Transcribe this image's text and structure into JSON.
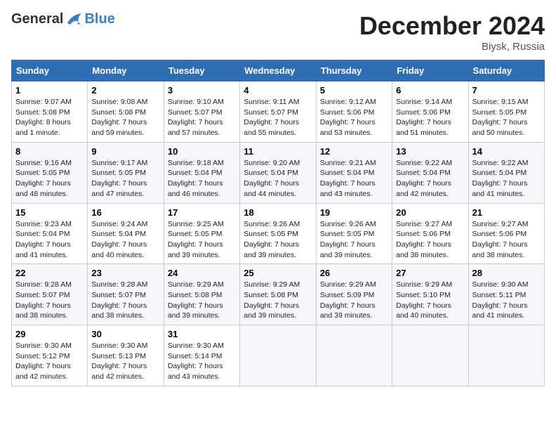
{
  "logo": {
    "general": "General",
    "blue": "Blue"
  },
  "title": "December 2024",
  "location": "Biysk, Russia",
  "days_header": [
    "Sunday",
    "Monday",
    "Tuesday",
    "Wednesday",
    "Thursday",
    "Friday",
    "Saturday"
  ],
  "weeks": [
    [
      {
        "day": "1",
        "info": "Sunrise: 9:07 AM\nSunset: 5:08 PM\nDaylight: 8 hours\nand 1 minute."
      },
      {
        "day": "2",
        "info": "Sunrise: 9:08 AM\nSunset: 5:08 PM\nDaylight: 7 hours\nand 59 minutes."
      },
      {
        "day": "3",
        "info": "Sunrise: 9:10 AM\nSunset: 5:07 PM\nDaylight: 7 hours\nand 57 minutes."
      },
      {
        "day": "4",
        "info": "Sunrise: 9:11 AM\nSunset: 5:07 PM\nDaylight: 7 hours\nand 55 minutes."
      },
      {
        "day": "5",
        "info": "Sunrise: 9:12 AM\nSunset: 5:06 PM\nDaylight: 7 hours\nand 53 minutes."
      },
      {
        "day": "6",
        "info": "Sunrise: 9:14 AM\nSunset: 5:06 PM\nDaylight: 7 hours\nand 51 minutes."
      },
      {
        "day": "7",
        "info": "Sunrise: 9:15 AM\nSunset: 5:05 PM\nDaylight: 7 hours\nand 50 minutes."
      }
    ],
    [
      {
        "day": "8",
        "info": "Sunrise: 9:16 AM\nSunset: 5:05 PM\nDaylight: 7 hours\nand 48 minutes."
      },
      {
        "day": "9",
        "info": "Sunrise: 9:17 AM\nSunset: 5:05 PM\nDaylight: 7 hours\nand 47 minutes."
      },
      {
        "day": "10",
        "info": "Sunrise: 9:18 AM\nSunset: 5:04 PM\nDaylight: 7 hours\nand 46 minutes."
      },
      {
        "day": "11",
        "info": "Sunrise: 9:20 AM\nSunset: 5:04 PM\nDaylight: 7 hours\nand 44 minutes."
      },
      {
        "day": "12",
        "info": "Sunrise: 9:21 AM\nSunset: 5:04 PM\nDaylight: 7 hours\nand 43 minutes."
      },
      {
        "day": "13",
        "info": "Sunrise: 9:22 AM\nSunset: 5:04 PM\nDaylight: 7 hours\nand 42 minutes."
      },
      {
        "day": "14",
        "info": "Sunrise: 9:22 AM\nSunset: 5:04 PM\nDaylight: 7 hours\nand 41 minutes."
      }
    ],
    [
      {
        "day": "15",
        "info": "Sunrise: 9:23 AM\nSunset: 5:04 PM\nDaylight: 7 hours\nand 41 minutes."
      },
      {
        "day": "16",
        "info": "Sunrise: 9:24 AM\nSunset: 5:04 PM\nDaylight: 7 hours\nand 40 minutes."
      },
      {
        "day": "17",
        "info": "Sunrise: 9:25 AM\nSunset: 5:05 PM\nDaylight: 7 hours\nand 39 minutes."
      },
      {
        "day": "18",
        "info": "Sunrise: 9:26 AM\nSunset: 5:05 PM\nDaylight: 7 hours\nand 39 minutes."
      },
      {
        "day": "19",
        "info": "Sunrise: 9:26 AM\nSunset: 5:05 PM\nDaylight: 7 hours\nand 39 minutes."
      },
      {
        "day": "20",
        "info": "Sunrise: 9:27 AM\nSunset: 5:06 PM\nDaylight: 7 hours\nand 38 minutes."
      },
      {
        "day": "21",
        "info": "Sunrise: 9:27 AM\nSunset: 5:06 PM\nDaylight: 7 hours\nand 38 minutes."
      }
    ],
    [
      {
        "day": "22",
        "info": "Sunrise: 9:28 AM\nSunset: 5:07 PM\nDaylight: 7 hours\nand 38 minutes."
      },
      {
        "day": "23",
        "info": "Sunrise: 9:28 AM\nSunset: 5:07 PM\nDaylight: 7 hours\nand 38 minutes."
      },
      {
        "day": "24",
        "info": "Sunrise: 9:29 AM\nSunset: 5:08 PM\nDaylight: 7 hours\nand 39 minutes."
      },
      {
        "day": "25",
        "info": "Sunrise: 9:29 AM\nSunset: 5:08 PM\nDaylight: 7 hours\nand 39 minutes."
      },
      {
        "day": "26",
        "info": "Sunrise: 9:29 AM\nSunset: 5:09 PM\nDaylight: 7 hours\nand 39 minutes."
      },
      {
        "day": "27",
        "info": "Sunrise: 9:29 AM\nSunset: 5:10 PM\nDaylight: 7 hours\nand 40 minutes."
      },
      {
        "day": "28",
        "info": "Sunrise: 9:30 AM\nSunset: 5:11 PM\nDaylight: 7 hours\nand 41 minutes."
      }
    ],
    [
      {
        "day": "29",
        "info": "Sunrise: 9:30 AM\nSunset: 5:12 PM\nDaylight: 7 hours\nand 42 minutes."
      },
      {
        "day": "30",
        "info": "Sunrise: 9:30 AM\nSunset: 5:13 PM\nDaylight: 7 hours\nand 42 minutes."
      },
      {
        "day": "31",
        "info": "Sunrise: 9:30 AM\nSunset: 5:14 PM\nDaylight: 7 hours\nand 43 minutes."
      },
      {
        "day": "",
        "info": ""
      },
      {
        "day": "",
        "info": ""
      },
      {
        "day": "",
        "info": ""
      },
      {
        "day": "",
        "info": ""
      }
    ]
  ]
}
